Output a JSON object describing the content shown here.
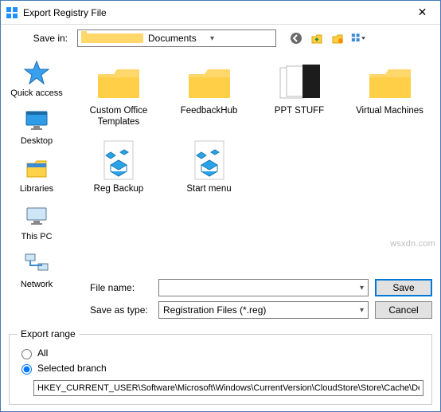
{
  "window": {
    "title": "Export Registry File",
    "close_glyph": "✕"
  },
  "toolbar": {
    "save_in_label": "Save in:",
    "save_in_value": "Documents"
  },
  "places": [
    {
      "label": "Quick access",
      "icon": "quick-access"
    },
    {
      "label": "Desktop",
      "icon": "desktop"
    },
    {
      "label": "Libraries",
      "icon": "libraries"
    },
    {
      "label": "This PC",
      "icon": "this-pc"
    },
    {
      "label": "Network",
      "icon": "network"
    }
  ],
  "items": [
    {
      "label": "Custom Office Templates",
      "icon": "folder"
    },
    {
      "label": "FeedbackHub",
      "icon": "folder"
    },
    {
      "label": "PPT STUFF",
      "icon": "ppt"
    },
    {
      "label": "Virtual Machines",
      "icon": "folder"
    },
    {
      "label": "Reg Backup",
      "icon": "regfile"
    },
    {
      "label": "Start menu",
      "icon": "regfile"
    }
  ],
  "fields": {
    "file_name_label": "File name:",
    "file_name_value": "",
    "save_as_type_label": "Save as type:",
    "save_as_type_value": "Registration Files (*.reg)"
  },
  "buttons": {
    "save": "Save",
    "cancel": "Cancel"
  },
  "export_range": {
    "legend": "Export range",
    "all": "All",
    "selected": "Selected branch",
    "branch_path": "HKEY_CURRENT_USER\\Software\\Microsoft\\Windows\\CurrentVersion\\CloudStore\\Store\\Cache\\Def"
  },
  "watermark": "wsxdn.com"
}
